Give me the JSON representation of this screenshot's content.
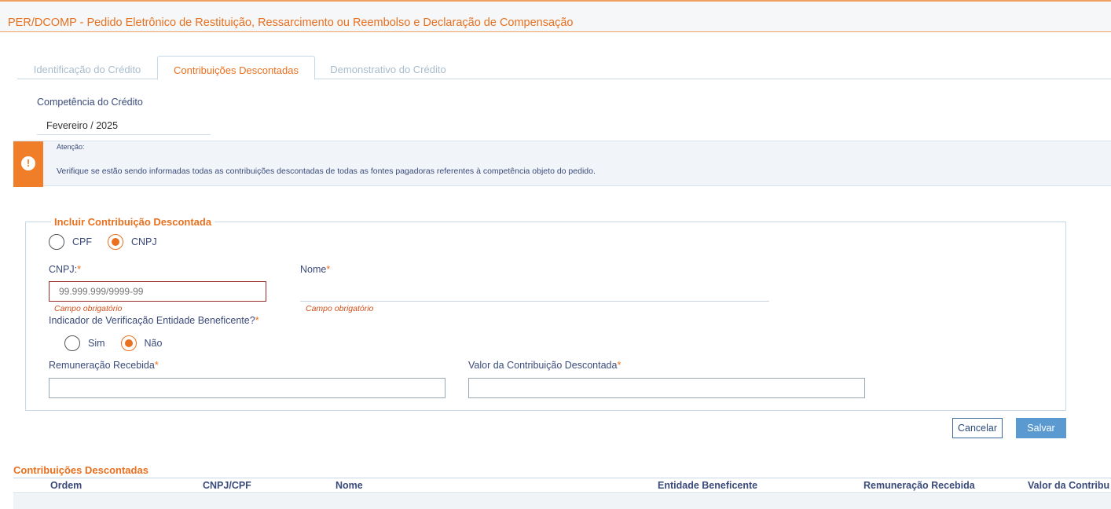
{
  "header": {
    "title": "PER/DCOMP - Pedido Eletrônico de Restituição, Ressarcimento ou Reembolso e Declaração de Compensação"
  },
  "tabs": [
    {
      "label": "Identificação do Crédito",
      "active": false
    },
    {
      "label": "Contribuições Descontadas",
      "active": true
    },
    {
      "label": "Demonstrativo do Crédito",
      "active": false
    }
  ],
  "competencia": {
    "label": "Competência do Crédito",
    "value": "Fevereiro / 2025"
  },
  "alert": {
    "icon": "exclamation-icon",
    "title": "Atenção:",
    "text": "Verifique se estão sendo informadas todas as contribuições descontadas de todas as fontes pagadoras referentes à competência objeto do pedido."
  },
  "form": {
    "legend": "Incluir Contribuição Descontada",
    "doc_type": {
      "options": [
        "CPF",
        "CNPJ"
      ],
      "selected": "CNPJ"
    },
    "cnpj": {
      "label": "CNPJ:",
      "required_mark": "*",
      "placeholder": "99.999.999/9999-99",
      "value": "",
      "error": "Campo obrigatório"
    },
    "nome": {
      "label": "Nome",
      "required_mark": "*",
      "value": "",
      "error": "Campo obrigatório"
    },
    "entidade": {
      "label": "Indicador de Verificação Entidade Beneficente?",
      "required_mark": "*",
      "options": [
        "Sim",
        "Não"
      ],
      "selected": "Não"
    },
    "remuneracao": {
      "label": "Remuneração Recebida",
      "required_mark": "*",
      "value": ""
    },
    "valor": {
      "label": "Valor da Contribuição Descontada",
      "required_mark": "*",
      "value": ""
    }
  },
  "buttons": {
    "cancel": "Cancelar",
    "save": "Salvar"
  },
  "table": {
    "title": "Contribuições Descontadas",
    "columns": [
      "Ordem",
      "CNPJ/CPF",
      "Nome",
      "Entidade Beneficente",
      "Remuneração Recebida",
      "Valor da Contribu"
    ],
    "rows": []
  },
  "colors": {
    "accent": "#e8701f",
    "primary": "#5a9ad0",
    "text": "#3a4a7a",
    "error": "#9b2c2c"
  }
}
